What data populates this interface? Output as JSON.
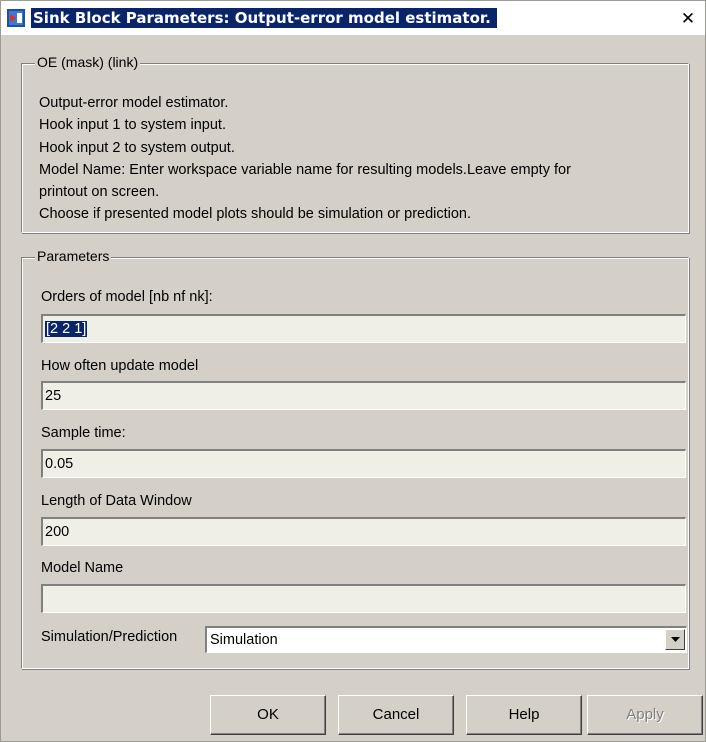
{
  "window": {
    "title": "Sink Block Parameters: Output-error model estimator.",
    "close_glyph": "✕",
    "icon": "simulink-block-icon"
  },
  "mask_group": {
    "title": "OE (mask) (link)",
    "description": [
      "Output-error model estimator.",
      "Hook input 1 to system input.",
      "Hook input 2 to system output.",
      "Model Name: Enter workspace variable name for resulting models.Leave empty for",
      "printout on screen.",
      "Choose if presented model plots should be simulation or prediction."
    ]
  },
  "parameters": {
    "title": "Parameters",
    "orders_label": "Orders of model [nb nf nk]:",
    "orders_value": "[2 2 1]",
    "update_label": "How often update model",
    "update_value": "25",
    "sample_label": "Sample time:",
    "sample_value": "0.05",
    "window_label": "Length of Data Window",
    "window_value": "200",
    "model_name_label": "Model Name",
    "model_name_value": "",
    "simpred_label": "Simulation/Prediction",
    "simpred_value": "Simulation"
  },
  "buttons": {
    "ok": "OK",
    "cancel": "Cancel",
    "help": "Help",
    "apply": "Apply"
  }
}
